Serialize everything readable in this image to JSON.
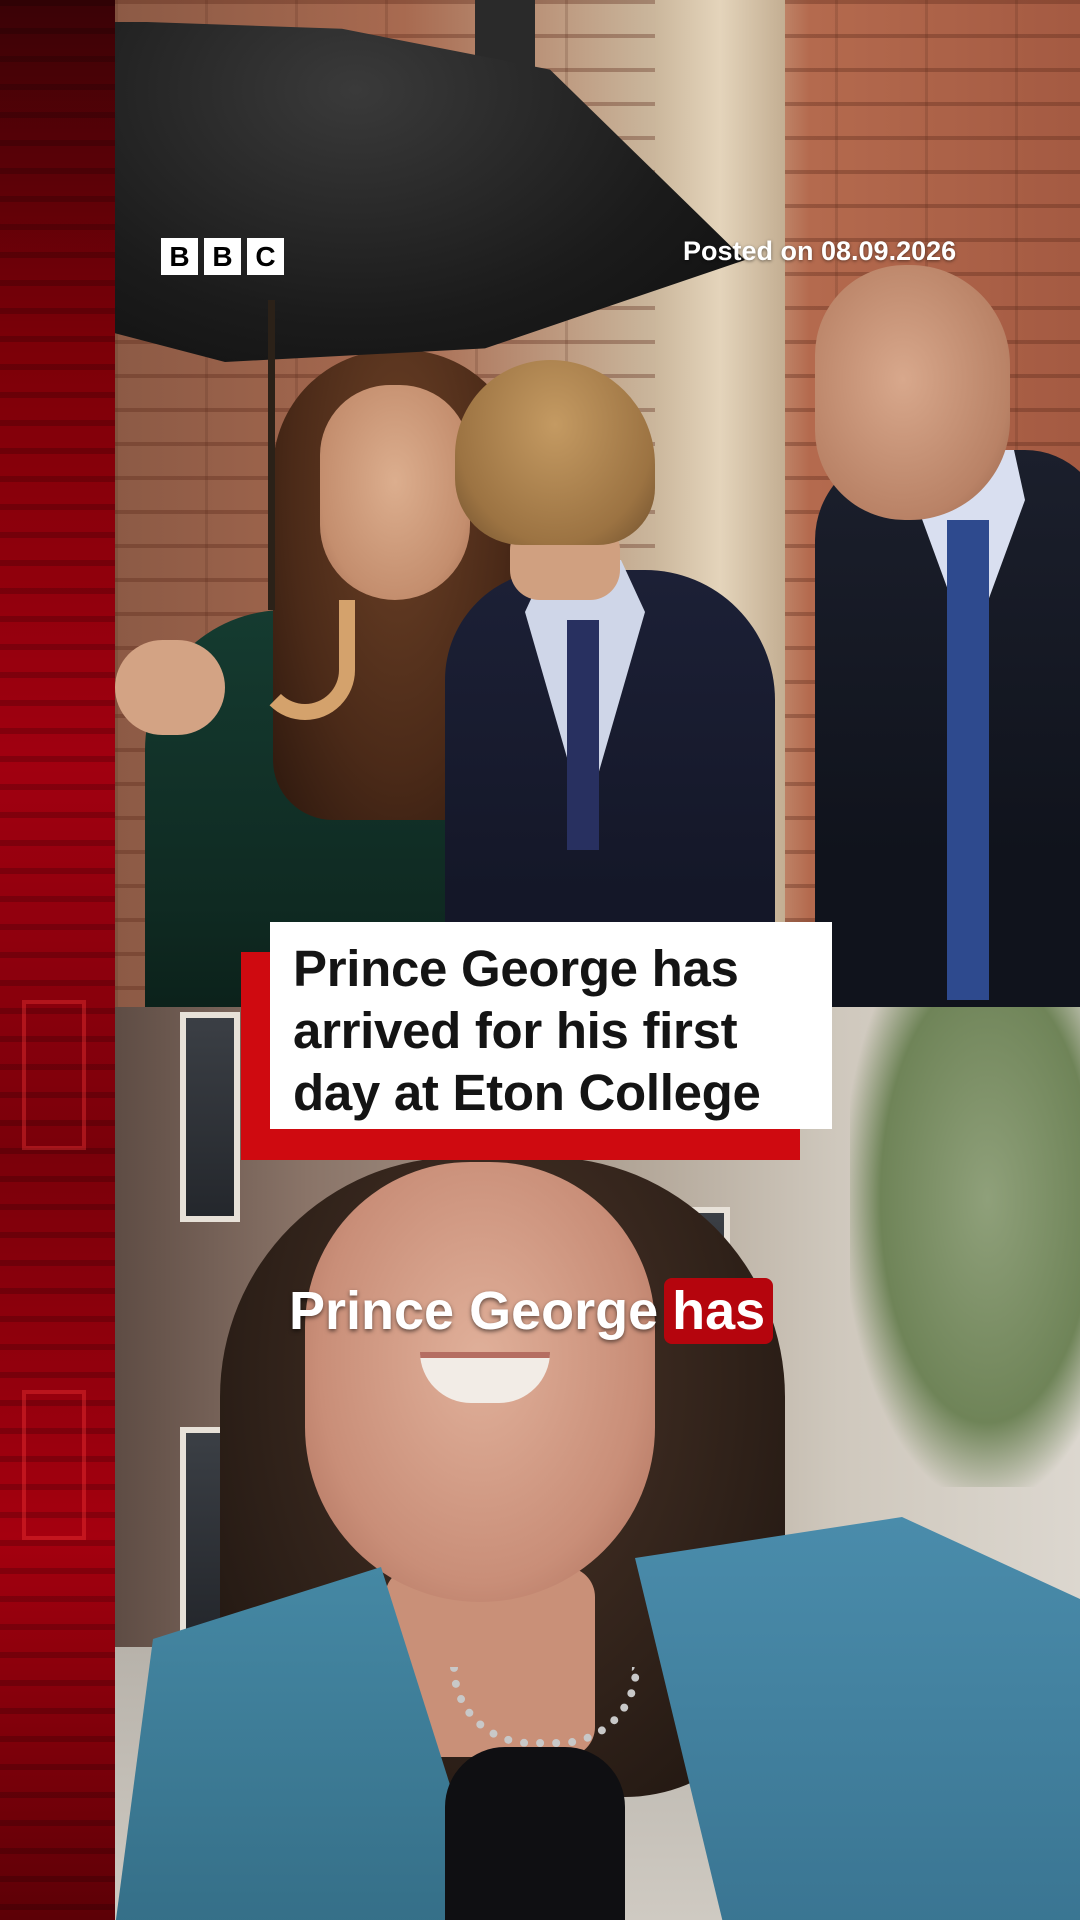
{
  "brand": {
    "logo_letters": [
      "B",
      "B",
      "C"
    ],
    "accent_color": "#cf0a10"
  },
  "post": {
    "posted_label": "Posted on 08.09.2026"
  },
  "headline": {
    "text": "Prince George has\narrived for his first\nday at Eton College"
  },
  "caption": {
    "text": "Prince George",
    "highlight": "has",
    "highlight_color": "#b5050d"
  }
}
